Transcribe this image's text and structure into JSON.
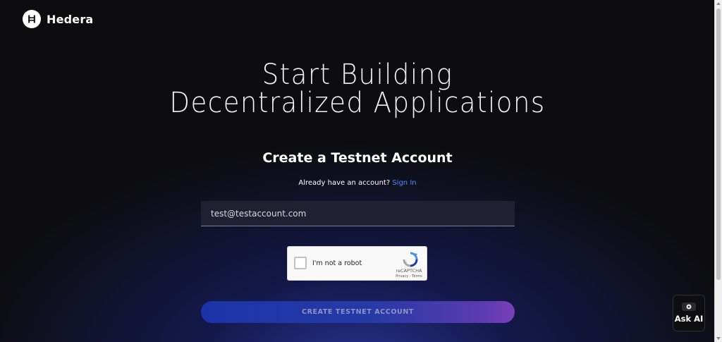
{
  "brand": {
    "name": "Hedera",
    "logo_icon": "hedera-h-icon"
  },
  "hero": {
    "line1": "Start Building",
    "line2": "Decentralized Applications"
  },
  "form": {
    "title": "Create a Testnet Account",
    "already_text": "Already have an account?",
    "signin_label": "Sign In",
    "email_value": "test@testaccount.com",
    "submit_label": "CREATE TESTNET ACCOUNT"
  },
  "captcha": {
    "label": "I'm not a robot",
    "brand": "reCAPTCHA",
    "terms": "Privacy - Terms",
    "icon": "recaptcha-icon"
  },
  "ask_ai": {
    "label": "Ask AI",
    "icon": "chat-bubble-icon"
  },
  "colors": {
    "background": "#0d0d0f",
    "link": "#4d8cff",
    "cta_start": "#1c33a8",
    "cta_end": "#7a3fb8"
  }
}
